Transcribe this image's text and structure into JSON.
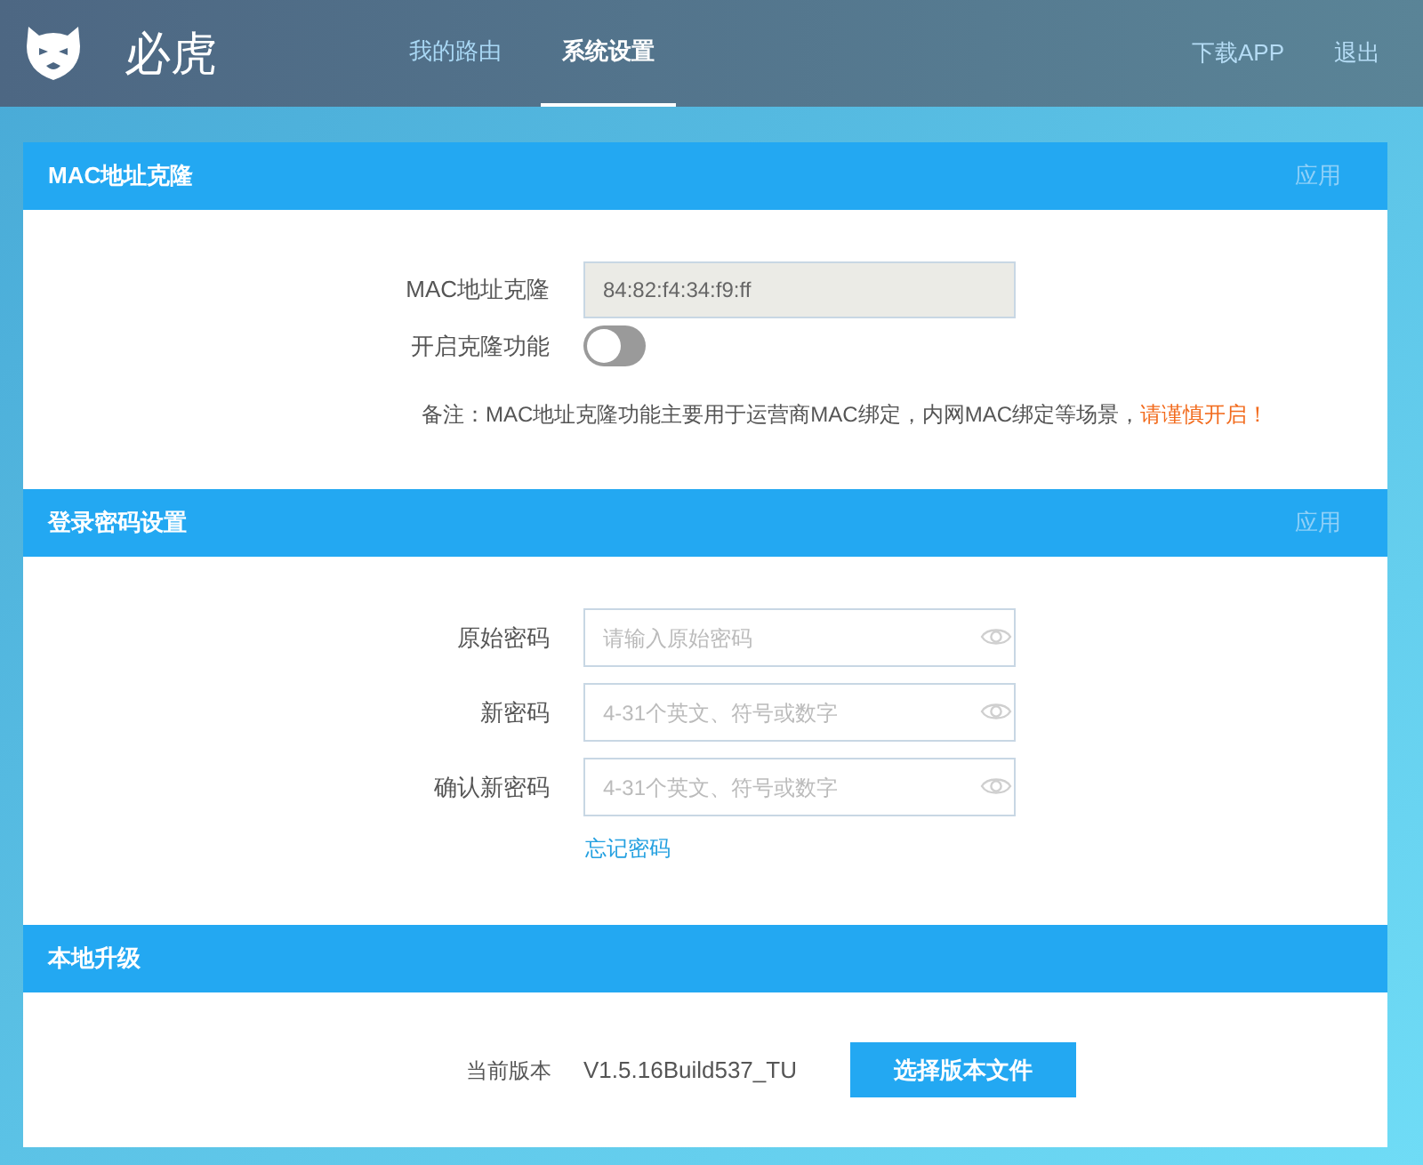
{
  "header": {
    "brand": "必虎",
    "nav": [
      {
        "label": "我的路由",
        "selected": false
      },
      {
        "label": "系统设置",
        "selected": true
      }
    ],
    "links": [
      "下载APP",
      "退出"
    ]
  },
  "mac_clone": {
    "title": "MAC地址克隆",
    "apply": "应用",
    "mac_label": "MAC地址克隆",
    "mac_value": "84:82:f4:34:f9:ff",
    "toggle_label": "开启克隆功能",
    "toggle_on": false,
    "note": "备注：MAC地址克隆功能主要用于运营商MAC绑定，内网MAC绑定等场景，",
    "warning": "请谨慎开启！"
  },
  "password": {
    "title": "登录密码设置",
    "apply": "应用",
    "fields": [
      {
        "label": "原始密码",
        "placeholder": "请输入原始密码"
      },
      {
        "label": "新密码",
        "placeholder": "4-31个英文、符号或数字"
      },
      {
        "label": "确认新密码",
        "placeholder": "4-31个英文、符号或数字"
      }
    ],
    "forgot": "忘记密码"
  },
  "upgrade": {
    "title": "本地升级",
    "version_label": "当前版本",
    "version": "V1.5.16Build537_TU",
    "button": "选择版本文件"
  }
}
